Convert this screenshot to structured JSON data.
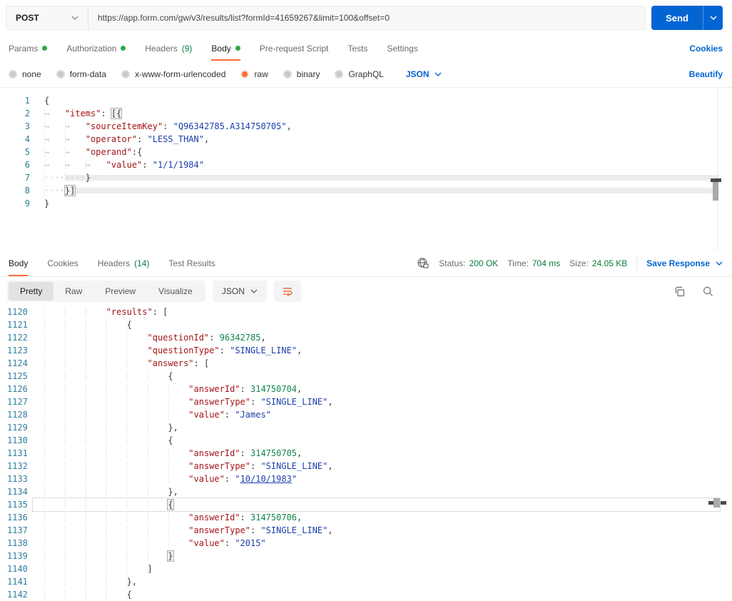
{
  "colors": {
    "accent_orange": "#FF6C37",
    "link_blue": "#0265D2",
    "green_dot": "#29A847",
    "green_text": "#0B7B3E",
    "code_key": "#A31515",
    "code_string": "#1C3FAA",
    "code_number": "#12854E",
    "line_number": "#2F7E9D"
  },
  "request_bar": {
    "method": "POST",
    "url": "https://app.form.com/gw/v3/results/list?formId=41659267&limit=100&offset=0",
    "send_label": "Send"
  },
  "request_tabs": {
    "tabs": [
      {
        "label": "Params",
        "dot": true
      },
      {
        "label": "Authorization",
        "dot": true
      },
      {
        "label": "Headers",
        "count": "(9)"
      },
      {
        "label": "Body",
        "dot": true,
        "active": true
      },
      {
        "label": "Pre-request Script"
      },
      {
        "label": "Tests"
      },
      {
        "label": "Settings"
      }
    ],
    "cookies_link": "Cookies"
  },
  "body_type_bar": {
    "options": [
      {
        "label": "none"
      },
      {
        "label": "form-data"
      },
      {
        "label": "x-www-form-urlencoded"
      },
      {
        "label": "raw",
        "selected": true
      },
      {
        "label": "binary"
      },
      {
        "label": "GraphQL"
      }
    ],
    "language": "JSON",
    "beautify_link": "Beautify"
  },
  "request_editor": {
    "lines": [
      {
        "n": "1",
        "segs": [
          [
            "sp",
            "{"
          ]
        ]
      },
      {
        "n": "2",
        "segs": [
          [
            "sw",
            "→   "
          ],
          [
            "sk",
            "\"items\""
          ],
          [
            "sp",
            ": "
          ],
          [
            "shl",
            "[{"
          ]
        ]
      },
      {
        "n": "3",
        "segs": [
          [
            "sw",
            "→   →   "
          ],
          [
            "sk",
            "\"sourceItemKey\""
          ],
          [
            "sp",
            ": "
          ],
          [
            "ss",
            "\"Q96342785.A314750705\""
          ],
          [
            "sp",
            ","
          ]
        ]
      },
      {
        "n": "4",
        "segs": [
          [
            "sw",
            "→   →   "
          ],
          [
            "sk",
            "\"operator\""
          ],
          [
            "sp",
            ": "
          ],
          [
            "ss",
            "\"LESS_THAN\""
          ],
          [
            "sp",
            ","
          ]
        ]
      },
      {
        "n": "5",
        "segs": [
          [
            "sw",
            "→   →   "
          ],
          [
            "sk",
            "\"operand\""
          ],
          [
            "sp",
            ":"
          ],
          [
            "sp",
            "{"
          ]
        ]
      },
      {
        "n": "6",
        "segs": [
          [
            "sw",
            "→   →   →   "
          ],
          [
            "sk",
            "\"value\""
          ],
          [
            "sp",
            ": "
          ],
          [
            "ss",
            "\"1/1/1984\""
          ]
        ]
      },
      {
        "n": "7",
        "segs": [
          [
            "sw",
            "········"
          ],
          [
            "sp",
            "}"
          ]
        ]
      },
      {
        "n": "8",
        "segs": [
          [
            "sw",
            "····"
          ],
          [
            "shl",
            "}]"
          ]
        ]
      },
      {
        "n": "9",
        "segs": [
          [
            "sp",
            "}"
          ]
        ]
      }
    ]
  },
  "response_header": {
    "tabs": [
      {
        "label": "Body",
        "active": true
      },
      {
        "label": "Cookies"
      },
      {
        "label": "Headers",
        "count": "(14)"
      },
      {
        "label": "Test Results"
      }
    ],
    "status_label": "Status:",
    "status_value": "200 OK",
    "time_label": "Time:",
    "time_value": "704 ms",
    "size_label": "Size:",
    "size_value": "24.05 KB",
    "save_label": "Save Response"
  },
  "response_toolbar": {
    "views": [
      {
        "label": "Pretty",
        "active": true
      },
      {
        "label": "Raw"
      },
      {
        "label": "Preview"
      },
      {
        "label": "Visualize"
      }
    ],
    "language": "JSON"
  },
  "response_editor": {
    "lines": [
      {
        "n": "1120",
        "segs": [
          [
            "sw",
            "            "
          ],
          [
            "sk",
            "\"results\""
          ],
          [
            "sp",
            ": ["
          ]
        ]
      },
      {
        "n": "1121",
        "segs": [
          [
            "sw",
            "                "
          ],
          [
            "sp",
            "{"
          ]
        ]
      },
      {
        "n": "1122",
        "segs": [
          [
            "sw",
            "                    "
          ],
          [
            "sk",
            "\"questionId\""
          ],
          [
            "sp",
            ": "
          ],
          [
            "sn",
            "96342785"
          ],
          [
            "sp",
            ","
          ]
        ]
      },
      {
        "n": "1123",
        "segs": [
          [
            "sw",
            "                    "
          ],
          [
            "sk",
            "\"questionType\""
          ],
          [
            "sp",
            ": "
          ],
          [
            "ss",
            "\"SINGLE_LINE\""
          ],
          [
            "sp",
            ","
          ]
        ]
      },
      {
        "n": "1124",
        "segs": [
          [
            "sw",
            "                    "
          ],
          [
            "sk",
            "\"answers\""
          ],
          [
            "sp",
            ": ["
          ]
        ]
      },
      {
        "n": "1125",
        "segs": [
          [
            "sw",
            "                        "
          ],
          [
            "sp",
            "{"
          ]
        ]
      },
      {
        "n": "1126",
        "segs": [
          [
            "sw",
            "                            "
          ],
          [
            "sk",
            "\"answerId\""
          ],
          [
            "sp",
            ": "
          ],
          [
            "sn",
            "314750704"
          ],
          [
            "sp",
            ","
          ]
        ]
      },
      {
        "n": "1127",
        "segs": [
          [
            "sw",
            "                            "
          ],
          [
            "sk",
            "\"answerType\""
          ],
          [
            "sp",
            ": "
          ],
          [
            "ss",
            "\"SINGLE_LINE\""
          ],
          [
            "sp",
            ","
          ]
        ]
      },
      {
        "n": "1128",
        "segs": [
          [
            "sw",
            "                            "
          ],
          [
            "sk",
            "\"value\""
          ],
          [
            "sp",
            ": "
          ],
          [
            "ss",
            "\"James\""
          ]
        ]
      },
      {
        "n": "1129",
        "segs": [
          [
            "sw",
            "                        "
          ],
          [
            "sp",
            "},"
          ]
        ]
      },
      {
        "n": "1130",
        "segs": [
          [
            "sw",
            "                        "
          ],
          [
            "sp",
            "{"
          ]
        ]
      },
      {
        "n": "1131",
        "segs": [
          [
            "sw",
            "                            "
          ],
          [
            "sk",
            "\"answerId\""
          ],
          [
            "sp",
            ": "
          ],
          [
            "sn",
            "314750705"
          ],
          [
            "sp",
            ","
          ]
        ]
      },
      {
        "n": "1132",
        "segs": [
          [
            "sw",
            "                            "
          ],
          [
            "sk",
            "\"answerType\""
          ],
          [
            "sp",
            ": "
          ],
          [
            "ss",
            "\"SINGLE_LINE\""
          ],
          [
            "sp",
            ","
          ]
        ]
      },
      {
        "n": "1133",
        "segs": [
          [
            "sw",
            "                            "
          ],
          [
            "sk",
            "\"value\""
          ],
          [
            "sp",
            ": "
          ],
          [
            "ss",
            "\""
          ],
          [
            "slink",
            "10/10/1983"
          ],
          [
            "ss",
            "\""
          ]
        ]
      },
      {
        "n": "1134",
        "segs": [
          [
            "sw",
            "                        "
          ],
          [
            "sp",
            "},"
          ]
        ]
      },
      {
        "n": "1135",
        "cur": true,
        "segs": [
          [
            "sw",
            "                        "
          ],
          [
            "shl",
            "{"
          ]
        ]
      },
      {
        "n": "1136",
        "segs": [
          [
            "sw",
            "                            "
          ],
          [
            "sk",
            "\"answerId\""
          ],
          [
            "sp",
            ": "
          ],
          [
            "sn",
            "314750706"
          ],
          [
            "sp",
            ","
          ]
        ]
      },
      {
        "n": "1137",
        "segs": [
          [
            "sw",
            "                            "
          ],
          [
            "sk",
            "\"answerType\""
          ],
          [
            "sp",
            ": "
          ],
          [
            "ss",
            "\"SINGLE_LINE\""
          ],
          [
            "sp",
            ","
          ]
        ]
      },
      {
        "n": "1138",
        "segs": [
          [
            "sw",
            "                            "
          ],
          [
            "sk",
            "\"value\""
          ],
          [
            "sp",
            ": "
          ],
          [
            "ss",
            "\"2015\""
          ]
        ]
      },
      {
        "n": "1139",
        "segs": [
          [
            "sw",
            "                        "
          ],
          [
            "shl",
            "}"
          ]
        ]
      },
      {
        "n": "1140",
        "segs": [
          [
            "sw",
            "                    "
          ],
          [
            "sp",
            "]"
          ]
        ]
      },
      {
        "n": "1141",
        "segs": [
          [
            "sw",
            "                "
          ],
          [
            "sp",
            "},"
          ]
        ]
      },
      {
        "n": "1142",
        "segs": [
          [
            "sw",
            "                "
          ],
          [
            "sp",
            "{"
          ]
        ]
      }
    ]
  }
}
